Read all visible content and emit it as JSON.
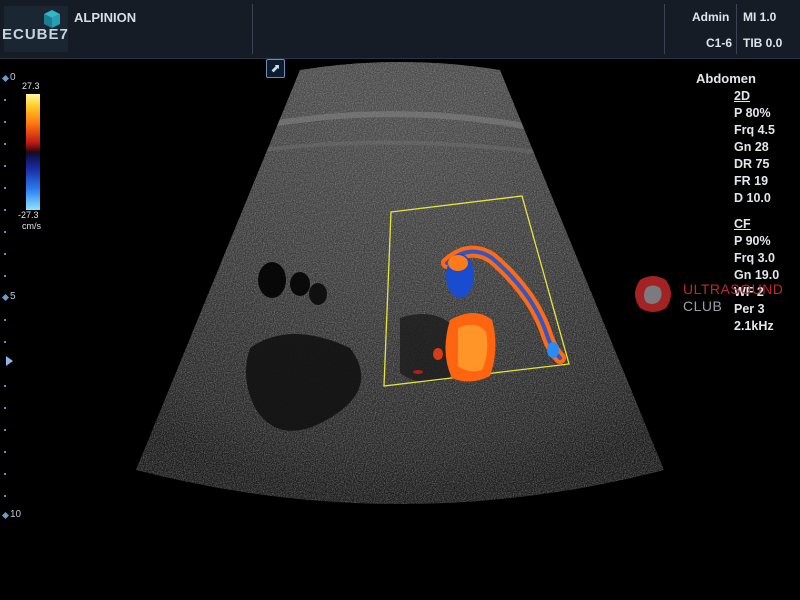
{
  "header": {
    "logo_text": "ECUBE7",
    "brand": "ALPINION",
    "user": "Admin",
    "mi": "MI 1.0",
    "probe": "C1-6",
    "tib": "TIB 0.0"
  },
  "colorbar": {
    "max": "27.3",
    "min": "-27.3",
    "unit": "cm/s"
  },
  "depth_scale": {
    "labels": [
      "0",
      "5",
      "10"
    ]
  },
  "preset": "Abdomen",
  "mode_2d": {
    "title": "2D",
    "lines": [
      "P 80%",
      "Frq 4.5",
      "Gn 28",
      "DR 75",
      "FR 19",
      "D 10.0"
    ]
  },
  "mode_cf": {
    "title": "CF",
    "lines": [
      "P 90%",
      "Frq 3.0",
      "Gn 19.0",
      "WF 2",
      "Per 3",
      "2.1kHz"
    ]
  },
  "watermark": {
    "line1": "ULTRASOUND",
    "line2": "CLUB"
  },
  "colors": {
    "header_bg": "#151c26",
    "roi_box": "#e5e53a",
    "watermark_red": "#c0282a"
  },
  "icons": [
    "ecube-logo-icon",
    "acoustic-mark-icon",
    "depth-marker-icon",
    "ultrasound-club-logo-icon"
  ]
}
